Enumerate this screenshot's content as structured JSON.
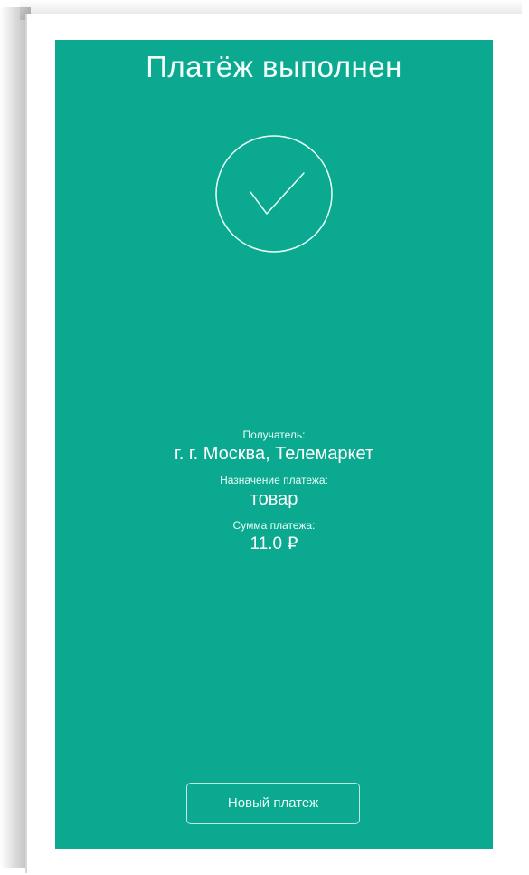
{
  "screen": {
    "title": "Платёж выполнен",
    "status_icon": "check-circle-icon",
    "background_color": "#0aa990"
  },
  "details": {
    "recipient_label": "Получатель:",
    "recipient_value": "г. г. Москва, Телемаркет",
    "purpose_label": "Назначение платежа:",
    "purpose_value": "товар",
    "amount_label": "Сумма платежа:",
    "amount_value": "11.0 ₽"
  },
  "actions": {
    "new_payment_label": "Новый платеж"
  }
}
